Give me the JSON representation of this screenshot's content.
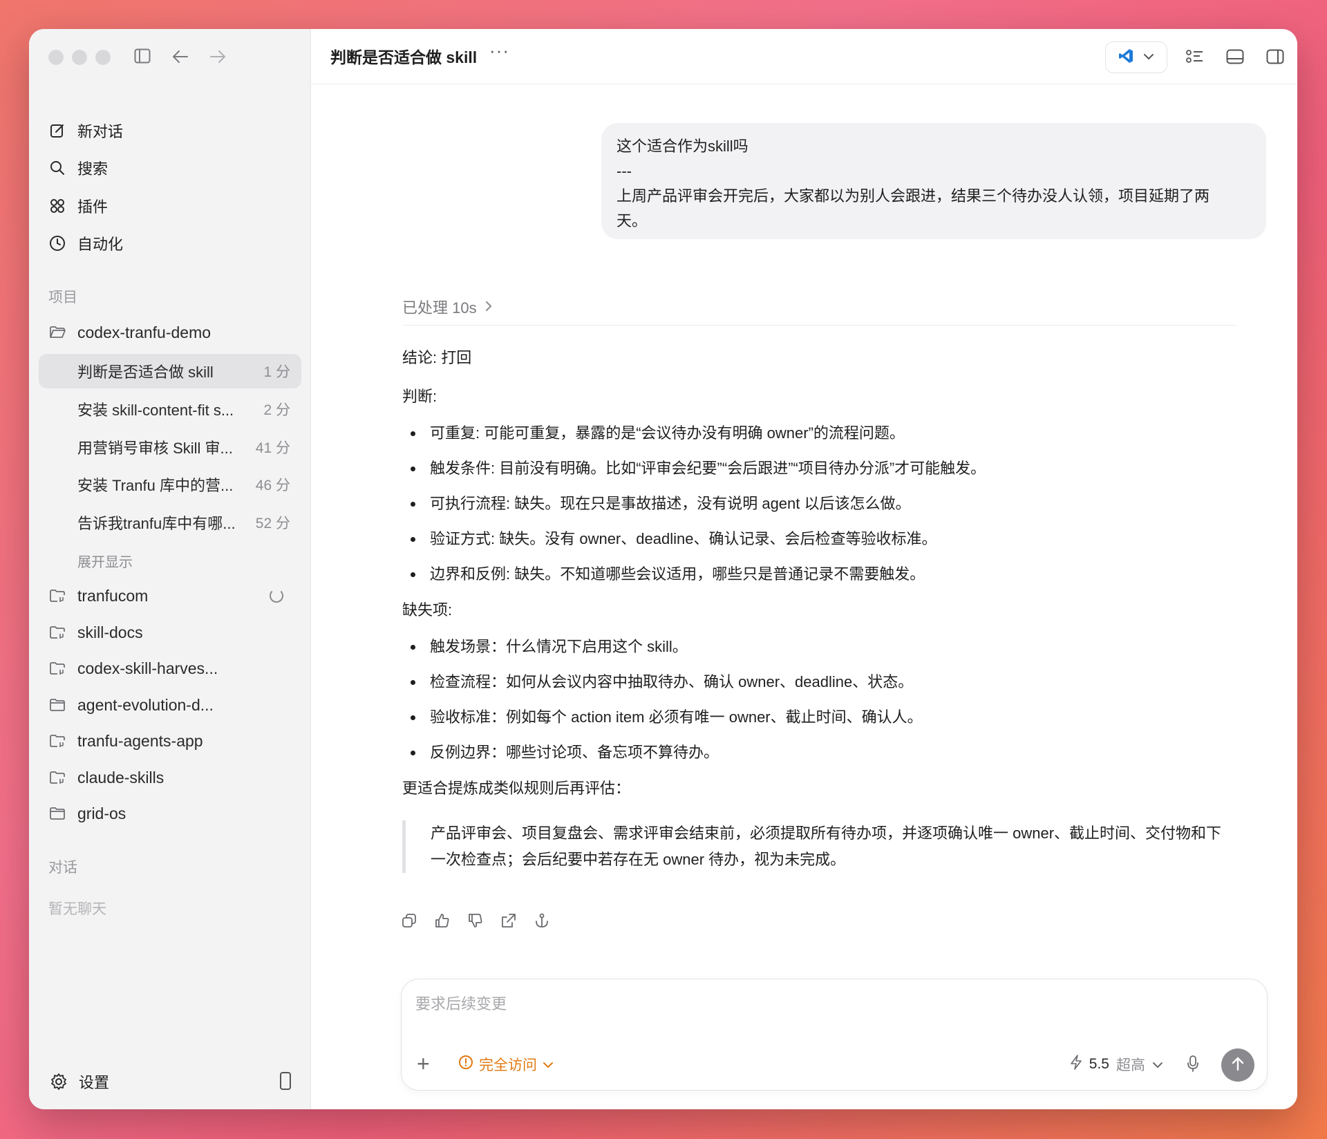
{
  "sidebar": {
    "nav": [
      {
        "label": "新对话",
        "icon": "edit-icon"
      },
      {
        "label": "搜索",
        "icon": "search-icon"
      },
      {
        "label": "插件",
        "icon": "plugin-icon"
      },
      {
        "label": "自动化",
        "icon": "clock-icon"
      }
    ],
    "projects_label": "项目",
    "active_project": "codex-tranfu-demo",
    "threads": [
      {
        "title": "判断是否适合做 skill",
        "age": "1 分",
        "active": true
      },
      {
        "title": "安装 skill-content-fit s...",
        "age": "2 分"
      },
      {
        "title": "用营销号审核 Skill 审...",
        "age": "41 分"
      },
      {
        "title": "安装 Tranfu 库中的营...",
        "age": "46 分"
      },
      {
        "title": "告诉我tranfu库中有哪...",
        "age": "52 分"
      }
    ],
    "expand_label": "展开显示",
    "projects": [
      {
        "name": "tranfucom",
        "loading": true
      },
      {
        "name": "skill-docs"
      },
      {
        "name": "codex-skill-harves..."
      },
      {
        "name": "agent-evolution-d..."
      },
      {
        "name": "tranfu-agents-app"
      },
      {
        "name": "claude-skills"
      },
      {
        "name": "grid-os"
      }
    ],
    "chats_label": "对话",
    "no_chats": "暂无聊天",
    "settings_label": "设置"
  },
  "header": {
    "title": "判断是否适合做 skill",
    "more": "···"
  },
  "conversation": {
    "user_message": {
      "line1": "这个适合作为skill吗",
      "line2": "---",
      "line3": "上周产品评审会开完后，大家都以为别人会跟进，结果三个待办没人认领，项目延期了两",
      "line4": "天。"
    },
    "processed": "已处理 10s",
    "answer": {
      "conclusion": "结论: 打回",
      "judgment_label": "判断:",
      "judgments": [
        "可重复: 可能可重复，暴露的是“会议待办没有明确 owner”的流程问题。",
        "触发条件: 目前没有明确。比如“评审会纪要”“会后跟进”“项目待办分派”才可能触发。",
        "可执行流程: 缺失。现在只是事故描述，没有说明 agent 以后该怎么做。",
        "验证方式: 缺失。没有 owner、deadline、确认记录、会后检查等验收标准。",
        "边界和反例: 缺失。不知道哪些会议适用，哪些只是普通记录不需要触发。"
      ],
      "missing_label": "缺失项:",
      "missing": [
        "触发场景：什么情况下启用这个 skill。",
        "检查流程：如何从会议内容中抽取待办、确认 owner、deadline、状态。",
        "验收标准：例如每个 action item 必须有唯一 owner、截止时间、确认人。",
        "反例边界：哪些讨论项、备忘项不算待办。"
      ],
      "suggest_label": "更适合提炼成类似规则后再评估：",
      "quote_line1": "产品评审会、项目复盘会、需求评审会结束前，必须提取所有待办项，并逐项确认唯一 owner、截止时间、交付物和下",
      "quote_line2": "一次检查点；会后纪要中若存在无 owner 待办，视为未完成。"
    }
  },
  "composer": {
    "placeholder": "要求后续变更",
    "access_label": "完全访问",
    "model_version": "5.5",
    "model_level": "超高"
  },
  "colors": {
    "accent_orange": "#e07a12",
    "vscode_blue": "#1f7ad8"
  }
}
